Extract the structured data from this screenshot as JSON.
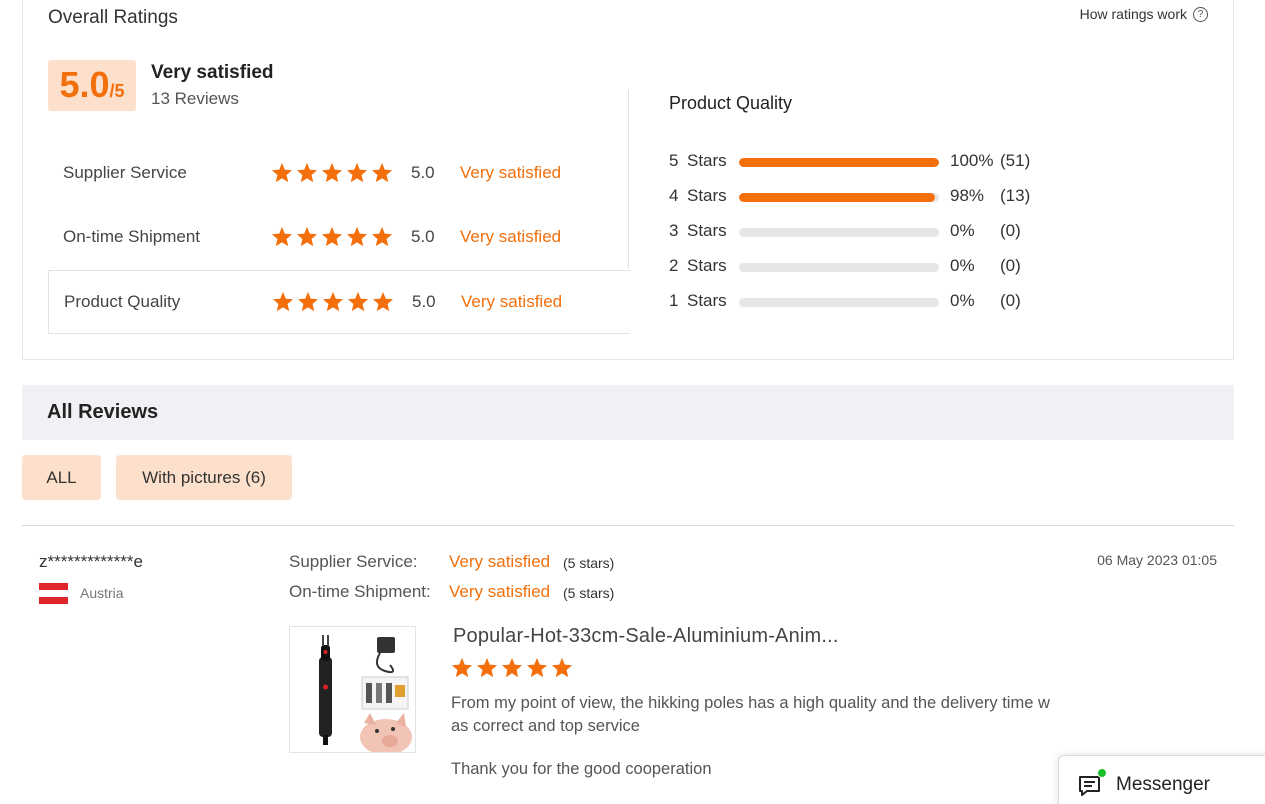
{
  "overall": {
    "title": "Overall Ratings",
    "how_ratings_label": "How ratings work",
    "score": "5.0",
    "score_suffix": "/5",
    "summary_label": "Very satisfied",
    "review_count": "13 Reviews"
  },
  "categories": [
    {
      "name": "Supplier Service",
      "stars": 5,
      "score": "5.0",
      "label": "Very satisfied"
    },
    {
      "name": "On-time Shipment",
      "stars": 5,
      "score": "5.0",
      "label": "Very satisfied"
    },
    {
      "name": "Product Quality",
      "stars": 5,
      "score": "5.0",
      "label": "Very satisfied"
    }
  ],
  "product_quality": {
    "title": "Product Quality",
    "distribution": [
      {
        "num": "5",
        "label": "Stars",
        "fraction": 1.0,
        "pct": "100%",
        "count": "(51)"
      },
      {
        "num": "4",
        "label": "Stars",
        "fraction": 0.98,
        "pct": "98%",
        "count": "(13)"
      },
      {
        "num": "3",
        "label": "Stars",
        "fraction": 0.0,
        "pct": "0%",
        "count": "(0)"
      },
      {
        "num": "2",
        "label": "Stars",
        "fraction": 0.0,
        "pct": "0%",
        "count": "(0)"
      },
      {
        "num": "1",
        "label": "Stars",
        "fraction": 0.0,
        "pct": "0%",
        "count": "(0)"
      }
    ]
  },
  "all_reviews": {
    "title": "All Reviews",
    "filters": {
      "all": "ALL",
      "with_pictures": "With pictures (6)"
    }
  },
  "review": {
    "reviewer": "z*************e",
    "country": "Austria",
    "supplier_service_label": "Supplier Service:",
    "supplier_service_value": "Very satisfied",
    "supplier_service_stars": "(5 stars)",
    "shipment_label": "On-time Shipment:",
    "shipment_value": "Very satisfied",
    "shipment_stars": "(5 stars)",
    "date": "06 May 2023 01:05",
    "product_title": "Popular-Hot-33cm-Sale-Aluminium-Anim...",
    "stars": 5,
    "text": "From my point of view, the hikking poles has a high quality and the delivery time w as correct and top service",
    "text_line1": "From my point of view, the hikking poles has a high quality and the delivery time w",
    "text_line2": "as correct and top service",
    "thanks": "Thank you for the good cooperation"
  },
  "messenger": {
    "label": "Messenger"
  },
  "colors": {
    "accent": "#f36f0b",
    "badge_bg": "#fde0cc",
    "bar_track": "#e6e6e6",
    "flag_red": "#e0262c"
  },
  "icons": [
    "star-icon",
    "help-circle-icon",
    "austria-flag-icon",
    "chat-icon"
  ]
}
